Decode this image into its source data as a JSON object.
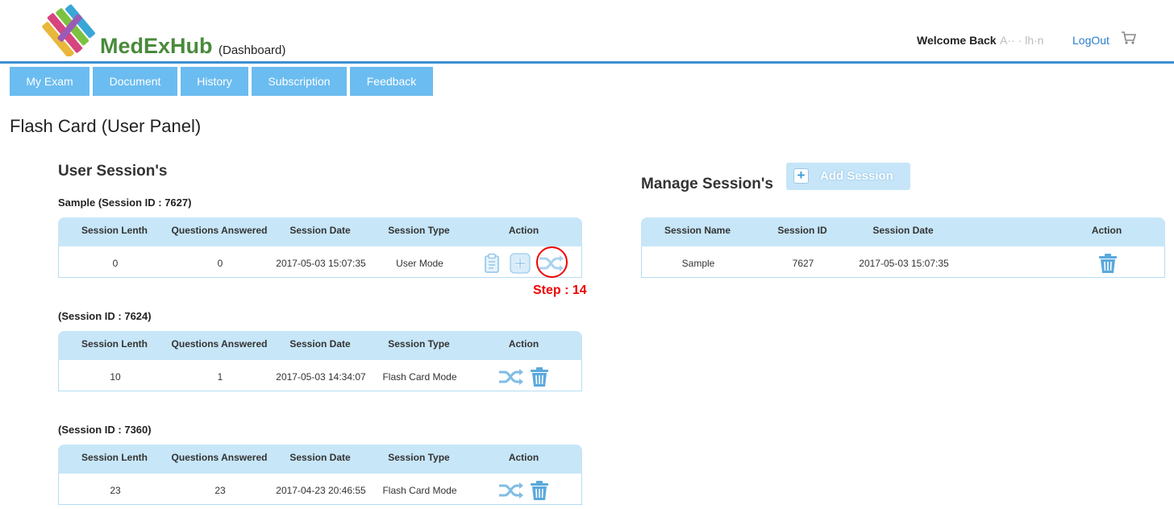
{
  "header": {
    "brand": "MedExHub",
    "brand_suffix": "(Dashboard)",
    "welcome": "Welcome Back",
    "username": "A·· · lh·n",
    "logout": "LogOut"
  },
  "nav": [
    "My Exam",
    "Document",
    "History",
    "Subscription",
    "Feedback"
  ],
  "page_title": "Flash Card (User Panel)",
  "user_sessions": {
    "title": "User Session's",
    "columns": [
      "Session Lenth",
      "Questions Answered",
      "Session Date",
      "Session Type",
      "Action"
    ],
    "sessions": [
      {
        "label": "Sample (Session ID : 7627)",
        "length": "0",
        "answered": "0",
        "date": "2017-05-03 15:07:35",
        "type": "User Mode"
      },
      {
        "label": "(Session ID : 7624)",
        "length": "10",
        "answered": "1",
        "date": "2017-05-03 14:34:07",
        "type": "Flash Card Mode"
      },
      {
        "label": "(Session ID : 7360)",
        "length": "23",
        "answered": "23",
        "date": "2017-04-23 20:46:55",
        "type": "Flash Card Mode"
      }
    ]
  },
  "step_label": "Step : 14",
  "manage_sessions": {
    "title": "Manage Session's",
    "add_button": "Add Session",
    "columns": [
      "Session Name",
      "Session ID",
      "Session Date",
      "Action"
    ],
    "rows": [
      {
        "name": "Sample",
        "id": "7627",
        "date": "2017-05-03 15:07:35"
      }
    ]
  },
  "icons": [
    "books-logo-icon",
    "cart-icon",
    "clipboard-icon",
    "plus-icon",
    "shuffle-icon",
    "trash-icon"
  ],
  "colors": {
    "nav": "#6bbcf0",
    "table_header": "#c7e6f8",
    "brand_green": "#4a8a3c",
    "link": "#2a7fc9",
    "step_red": "#ee0000",
    "icon_blue": "#5aa9dc"
  }
}
